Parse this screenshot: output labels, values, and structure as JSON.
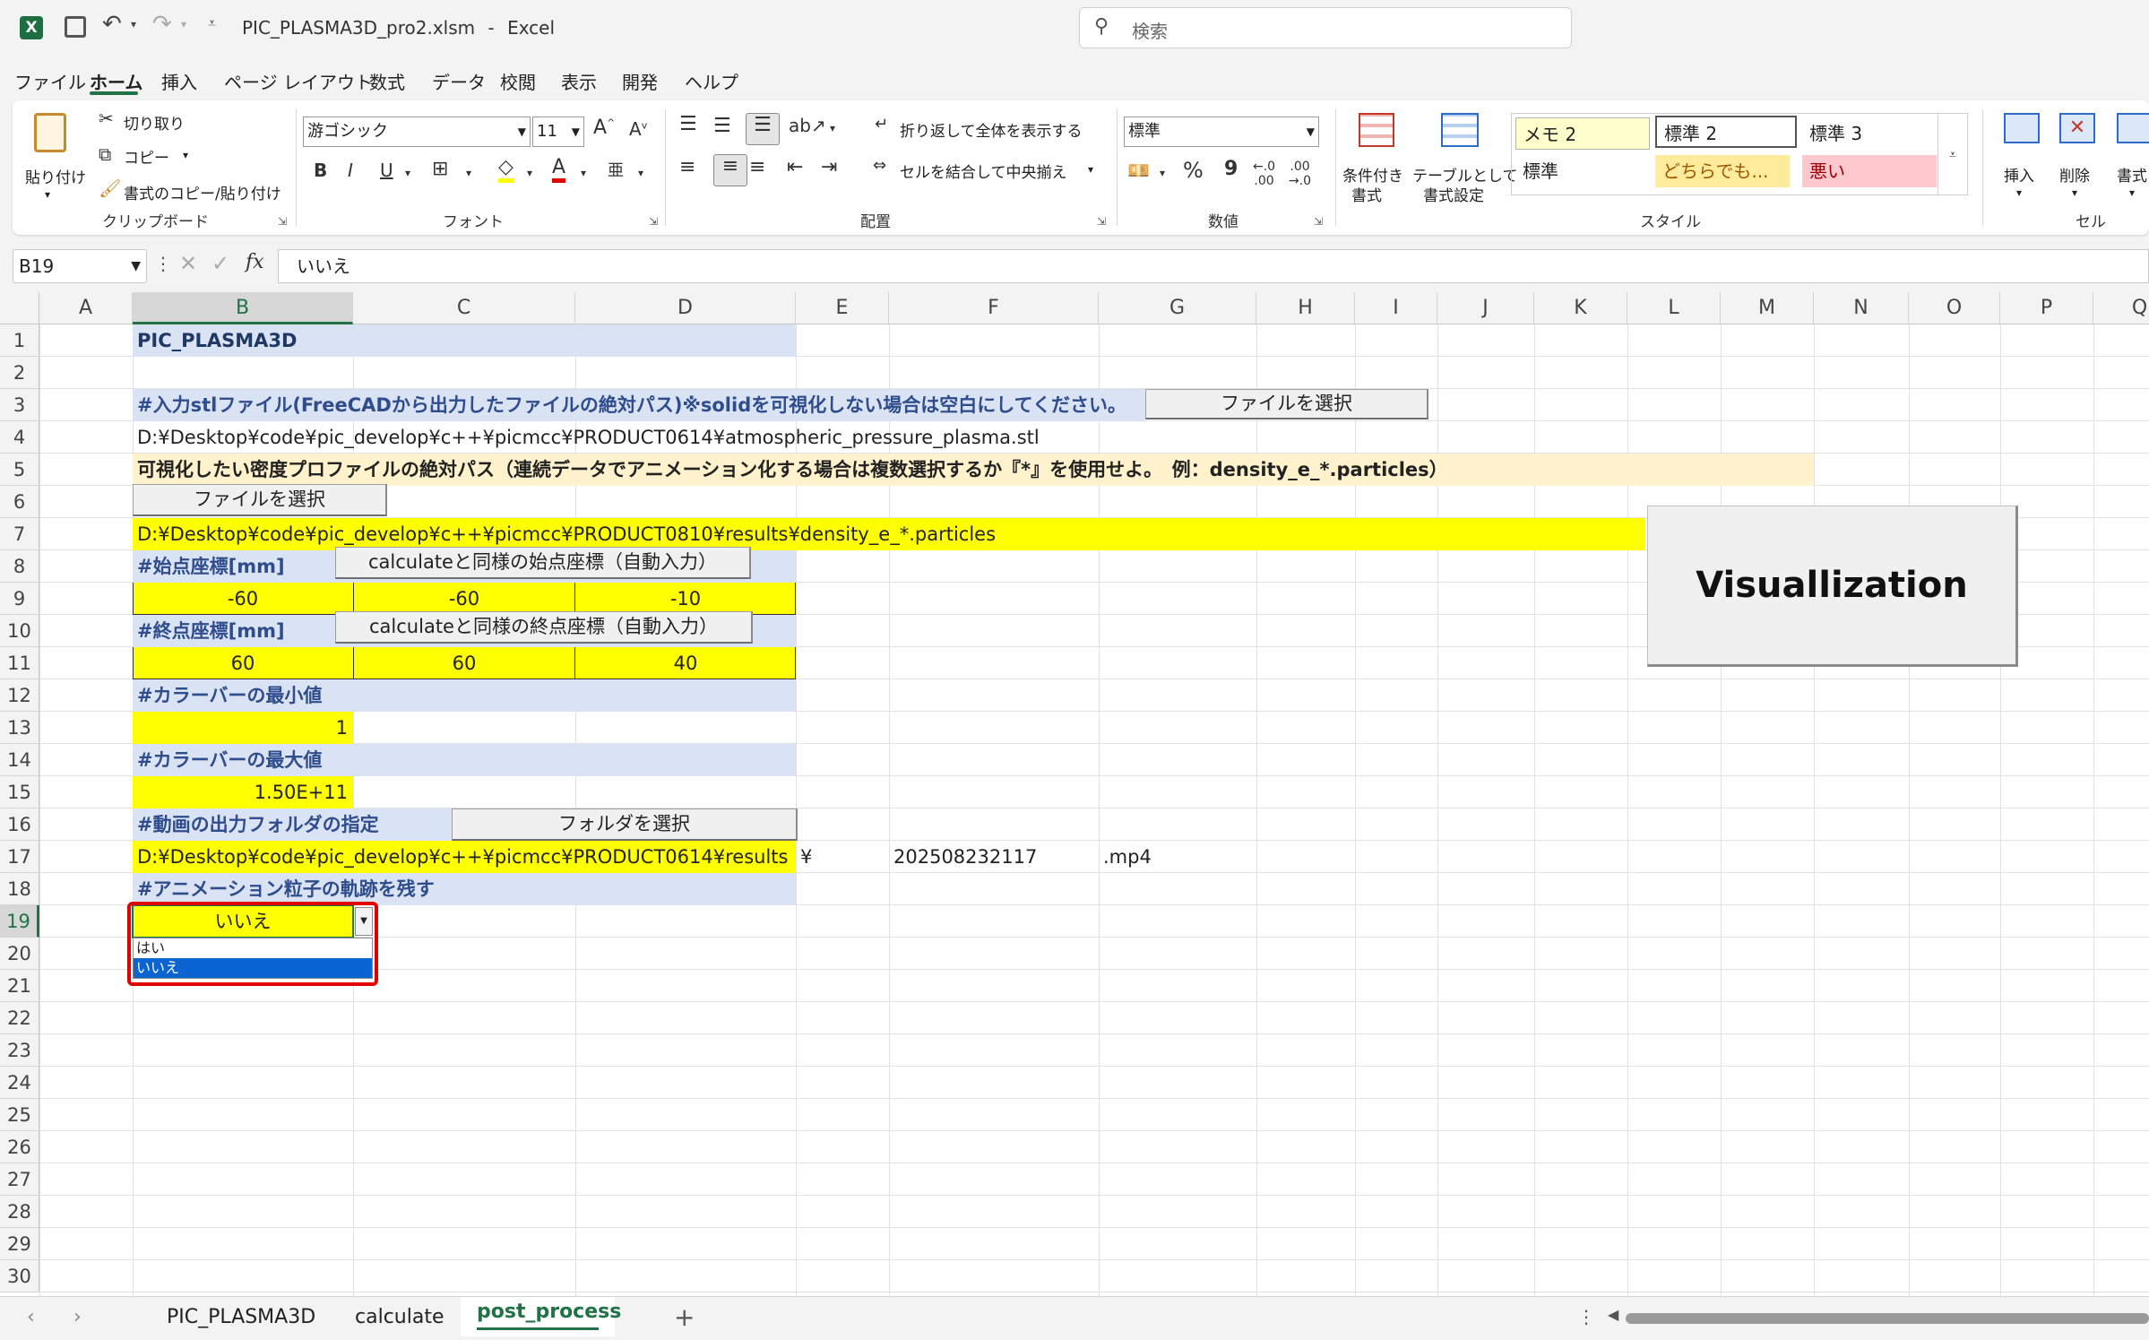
{
  "titlebar": {
    "filename": "PIC_PLASMA3D_pro2.xlsm",
    "separator": "-",
    "app": "Excel",
    "search_placeholder": "検索"
  },
  "ribbon_tabs": [
    "ファイル",
    "ホーム",
    "挿入",
    "ページ レイアウト",
    "数式",
    "データ",
    "校閲",
    "表示",
    "開発",
    "ヘルプ"
  ],
  "clipboard": {
    "paste": "貼り付け",
    "cut": "切り取り",
    "copy": "コピー",
    "format_painter": "書式のコピー/貼り付け",
    "group": "クリップボード"
  },
  "font": {
    "name": "游ゴシック",
    "size": "11",
    "group": "フォント",
    "bold": "B",
    "italic": "I",
    "underline": "U"
  },
  "alignment": {
    "wrap": "折り返して全体を表示する",
    "merge": "セルを結合して中央揃え",
    "group": "配置"
  },
  "number": {
    "format": "標準",
    "percent": "%",
    "comma": "9",
    "group": "数値"
  },
  "styles": {
    "conditional": [
      "条件付き",
      "書式"
    ],
    "table": [
      "テーブルとして",
      "書式設定"
    ],
    "cells": [
      "メモ 2",
      "標準 2",
      "標準 3",
      "標準",
      "どちらでも...",
      "悪い"
    ],
    "group": "スタイル"
  },
  "cells_group": {
    "insert": "挿入",
    "delete": "削除",
    "format": "書式",
    "group": "セル"
  },
  "formula_bar": {
    "name_box": "B19",
    "fx": "fx",
    "content": "いいえ"
  },
  "columns": [
    "A",
    "B",
    "C",
    "D",
    "E",
    "F",
    "G",
    "H",
    "I",
    "J",
    "K",
    "L",
    "M",
    "N",
    "O",
    "P",
    "Q"
  ],
  "rows": [
    "1",
    "2",
    "3",
    "4",
    "5",
    "6",
    "7",
    "8",
    "9",
    "10",
    "11",
    "12",
    "13",
    "14",
    "15",
    "16",
    "17",
    "18",
    "19",
    "20",
    "21",
    "22",
    "23",
    "24",
    "25",
    "26",
    "27",
    "28",
    "29",
    "30"
  ],
  "sheet": {
    "title": "PIC_PLASMA3D",
    "stl_label": "#入力stlファイル(FreeCADから出力したファイルの絶対パス)※solidを可視化しない場合は空白にしてください。",
    "stl_button": "ファイルを選択",
    "stl_path": "D:¥Desktop¥code¥pic_develop¥c++¥picmcc¥PRODUCT0614¥atmospheric_pressure_plasma.stl",
    "density_label": "可視化したい密度プロファイルの絶対パス（連続データでアニメーション化する場合は複数選択するか『*』を使用せよ。　例：density_e_*.particles）",
    "density_button": "ファイルを選択",
    "density_path": "D:¥Desktop¥code¥pic_develop¥c++¥picmcc¥PRODUCT0810¥results¥density_e_*.particles",
    "start_label": "#始点座標[mm]",
    "start_button": "calculateと同様の始点座標（自動入力）",
    "start_values": [
      "-60",
      "-60",
      "-10"
    ],
    "end_label": "#終点座標[mm]",
    "end_button": "calculateと同様の終点座標（自動入力）",
    "end_values": [
      "60",
      "60",
      "40"
    ],
    "cmin_label": "#カラーバーの最小値",
    "cmin_value": "1",
    "cmax_label": "#カラーバーの最大値",
    "cmax_value": "1.50E+11",
    "folder_label": "#動画の出力フォルダの指定",
    "folder_button": "フォルダを選択",
    "folder_path": "D:¥Desktop¥code¥pic_develop¥c++¥picmcc¥PRODUCT0614¥results",
    "yen": "¥",
    "timestamp": "202508232117",
    "ext": ".mp4",
    "trail_label": "#アニメーション粒子の軌跡を残す",
    "trail_value": "いいえ",
    "options": [
      "はい",
      "いいえ"
    ],
    "visualize_button": "Visuallization"
  },
  "sheet_tabs": [
    "PIC_PLASMA3D",
    "calculate",
    "post_process"
  ],
  "active_sheet": "post_process",
  "colors": {
    "yellow": "#ffff00",
    "header_fill": "#dae3f3",
    "label_text": "#2f4d8c",
    "cream": "#fff2cc",
    "highlight_red": "#e00000",
    "selection_blue": "#0a64d2",
    "excel_green": "#217346"
  }
}
